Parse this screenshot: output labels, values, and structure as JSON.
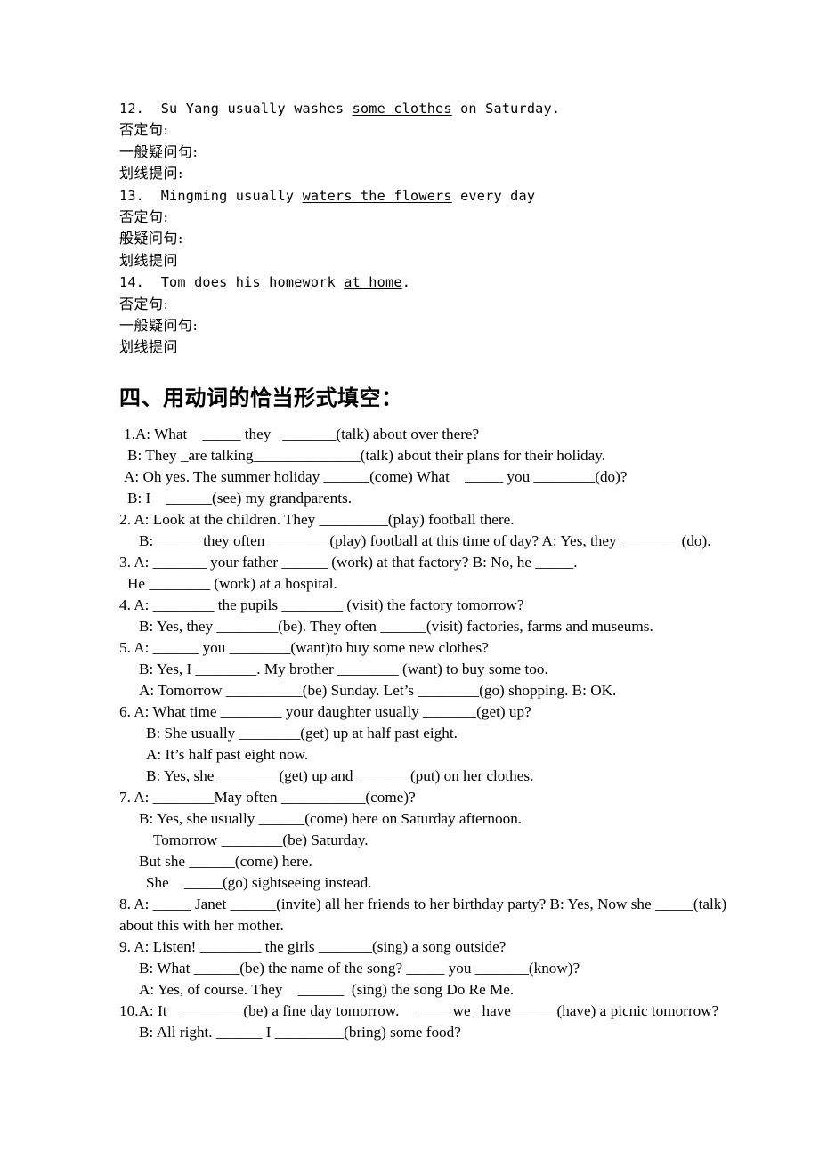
{
  "document": {
    "type": "worksheet",
    "language": "English / Chinese",
    "page_background": "#ffffff",
    "text_color": "#000000"
  },
  "sentence_transform_section": {
    "items": [
      {
        "number": "12.",
        "sentence_pre": "12.  Su Yang usually washes ",
        "sentence_underlined": "some clothes",
        "sentence_post": " on Saturday.",
        "prompts": [
          "否定句:",
          "一般疑问句:",
          "划线提问:"
        ]
      },
      {
        "number": "13.",
        "sentence_pre": "13.  Mingming usually ",
        "sentence_underlined": "waters the flowers",
        "sentence_post": " every day",
        "prompts": [
          "否定句:",
          "般疑问句:",
          "划线提问"
        ]
      },
      {
        "number": "14.",
        "sentence_pre": "14.  Tom does his homework ",
        "sentence_underlined": "at home",
        "sentence_post": ".",
        "prompts": [
          "否定句:",
          "一般疑问句:",
          "划线提问"
        ]
      }
    ]
  },
  "verb_form_section": {
    "heading": "四、用动词的恰当形式填空：",
    "lines": [
      {
        "indent": 1,
        "text": "1.A: What    _____ they   _______(talk) about over there?"
      },
      {
        "indent": 2,
        "text": "B: They _are talking______________(talk) about their plans for their holiday."
      },
      {
        "indent": 1,
        "text": "A: Oh yes. The summer holiday ______(come) What    _____ you ________(do)?"
      },
      {
        "indent": 2,
        "text": "B: I    ______(see) my grandparents."
      },
      {
        "indent": 0,
        "text": "2. A: Look at the children. They _________(play) football there."
      },
      {
        "indent": 3,
        "text": "B:______ they often ________(play) football at this time of day? A: Yes, they ________(do)."
      },
      {
        "indent": 0,
        "text": "3. A: _______ your father ______ (work) at that factory? B: No, he _____."
      },
      {
        "indent": 2,
        "text": "He ________ (work) at a hospital."
      },
      {
        "indent": 0,
        "text": "4. A: ________ the pupils ________ (visit) the factory tomorrow?"
      },
      {
        "indent": 3,
        "text": "B: Yes, they ________(be). They often ______(visit) factories, farms and museums."
      },
      {
        "indent": 0,
        "text": "5. A: ______ you ________(want)to buy some new clothes?"
      },
      {
        "indent": 3,
        "text": "B: Yes, I ________. My brother ________ (want) to buy some too."
      },
      {
        "indent": 3,
        "text": "A: Tomorrow __________(be) Sunday. Let’s ________(go) shopping. B: OK."
      },
      {
        "indent": 0,
        "text": "6. A: What time ________ your daughter usually _______(get) up?"
      },
      {
        "indent": 4,
        "text": "B: She usually ________(get) up at half past eight."
      },
      {
        "indent": 4,
        "text": "A: It’s half past eight now."
      },
      {
        "indent": 4,
        "text": "B: Yes, she ________(get) up and _______(put) on her clothes."
      },
      {
        "indent": 0,
        "text": "7. A: ________May often ___________(come)?"
      },
      {
        "indent": 3,
        "text": "B: Yes, she usually ______(come) here on Saturday afternoon."
      },
      {
        "indent": 5,
        "text": "Tomorrow ________(be) Saturday."
      },
      {
        "indent": 3,
        "text": "But she ______(come) here."
      },
      {
        "indent": 4,
        "text": "She    _____(go) sightseeing instead."
      },
      {
        "indent": 0,
        "text": "8. A: _____ Janet ______(invite) all her friends to her birthday party? B: Yes, Now she _____(talk)"
      },
      {
        "indent": 0,
        "text": "about this with her mother."
      },
      {
        "indent": 0,
        "text": "9. A: Listen! ________ the girls _______(sing) a song outside?"
      },
      {
        "indent": 3,
        "text": "B: What ______(be) the name of the song? _____ you _______(know)?"
      },
      {
        "indent": 3,
        "text": "A: Yes, of course. They    ______  (sing) the song Do Re Me."
      },
      {
        "indent": 0,
        "text": "10.A: It    ________(be) a fine day tomorrow.     ____ we _have______(have) a picnic tomorrow?"
      },
      {
        "indent": 3,
        "text": "B: All right. ______ I _________(bring) some food?"
      }
    ]
  }
}
